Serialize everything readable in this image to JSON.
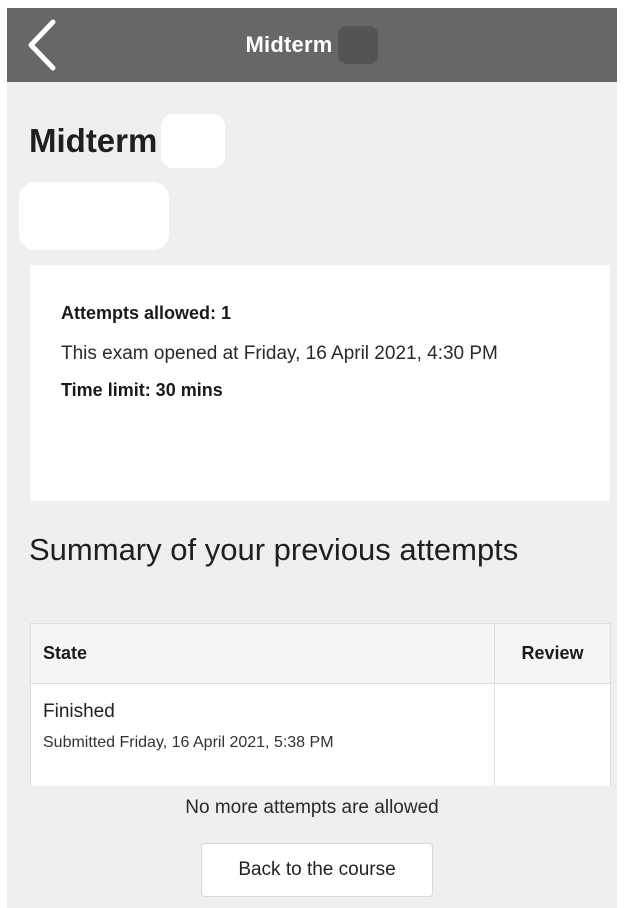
{
  "app_bar": {
    "title": "Midterm",
    "back_icon": "chevron-left-icon",
    "background": "#676767"
  },
  "page": {
    "title": "Midterm"
  },
  "info": {
    "attempts_allowed": "Attempts allowed: 1",
    "opened": "This exam opened at Friday, 16 April 2021, 4:30 PM",
    "time_limit": "Time limit: 30 mins"
  },
  "summary": {
    "heading": "Summary of your previous attempts",
    "columns": {
      "state": "State",
      "review": "Review"
    },
    "rows": [
      {
        "state": "Finished",
        "submitted": "Submitted Friday, 16 April 2021, 5:38 PM",
        "review": ""
      }
    ]
  },
  "footer": {
    "message": "No more attempts are allowed",
    "back_button": "Back to the course"
  }
}
